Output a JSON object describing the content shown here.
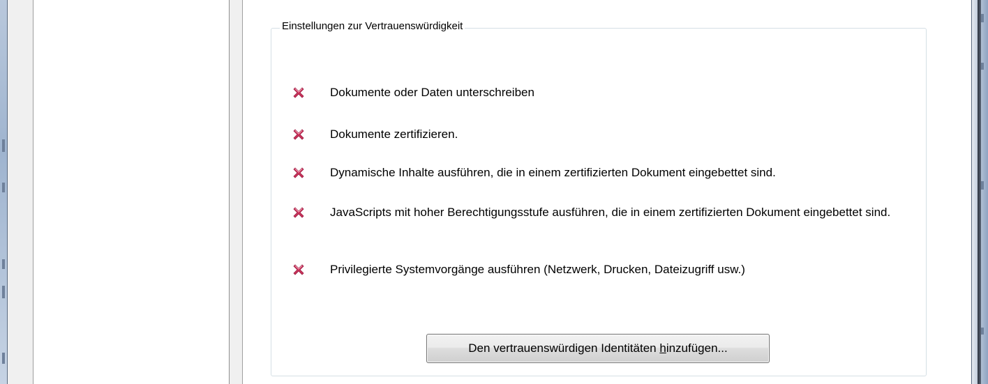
{
  "groupbox": {
    "title": "Einstellungen zur Vertrauenswürdigkeit"
  },
  "permissions": [
    {
      "icon": "deny-x-icon",
      "label": "Dokumente oder Daten unterschreiben"
    },
    {
      "icon": "deny-x-icon",
      "label": "Dokumente zertifizieren."
    },
    {
      "icon": "deny-x-icon",
      "label": "Dynamische Inhalte ausführen, die in einem zertifizierten Dokument eingebettet sind."
    },
    {
      "icon": "deny-x-icon",
      "label": "JavaScripts mit hoher Berechtigungsstufe ausführen, die in einem zertifizierten Dokument eingebettet sind."
    },
    {
      "icon": "deny-x-icon",
      "label": "Privilegierte Systemvorgänge ausführen (Netzwerk, Drucken, Dateizugriff usw.)"
    }
  ],
  "add_button": {
    "label_before": "Den vertrauenswürdigen Identitäten ",
    "label_accel": "h",
    "label_after": "inzufügen..."
  },
  "colors": {
    "deny_icon": "#c8335a",
    "groupbox_border": "#d5dfe5",
    "frame": "#9fb4cf"
  }
}
